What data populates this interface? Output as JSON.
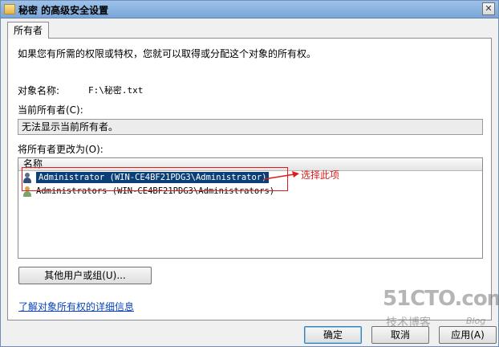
{
  "window": {
    "title": "秘密 的高级安全设置",
    "close_symbol": "✕"
  },
  "tabs": [
    {
      "label": "所有者"
    }
  ],
  "panel": {
    "intro": "如果您有所需的权限或特权，您就可以取得或分配这个对象的所有权。",
    "object_name_label": "对象名称:",
    "object_name_value": "F:\\秘密.txt",
    "current_owner_label": "当前所有者(C):",
    "current_owner_value": "无法显示当前所有者。",
    "change_owner_label": "将所有者更改为(O):",
    "list": {
      "column_header": "名称",
      "rows": [
        {
          "icon": "user-icon",
          "text": "Administrator (WIN-CE4BF21PDG3\\Administrator)",
          "selected": true
        },
        {
          "icon": "group-icon",
          "text": "Administrators (WIN-CE4BF21PDG3\\Administrators)",
          "selected": false
        }
      ]
    },
    "other_users_button": "其他用户或组(U)...",
    "learn_more_link": "了解对象所有权的详细信息"
  },
  "annotation": {
    "text": "选择此项",
    "color": "#e01b1b"
  },
  "buttons": {
    "ok": "确定",
    "cancel": "取消",
    "apply": "应用(A)"
  },
  "watermark": {
    "main": "51CTO.com",
    "sub": "技术博客",
    "blog": "Blog"
  },
  "colors": {
    "selection": "#0b3f78",
    "link": "#0b44b8",
    "titlebar": "#8fb6e3"
  }
}
